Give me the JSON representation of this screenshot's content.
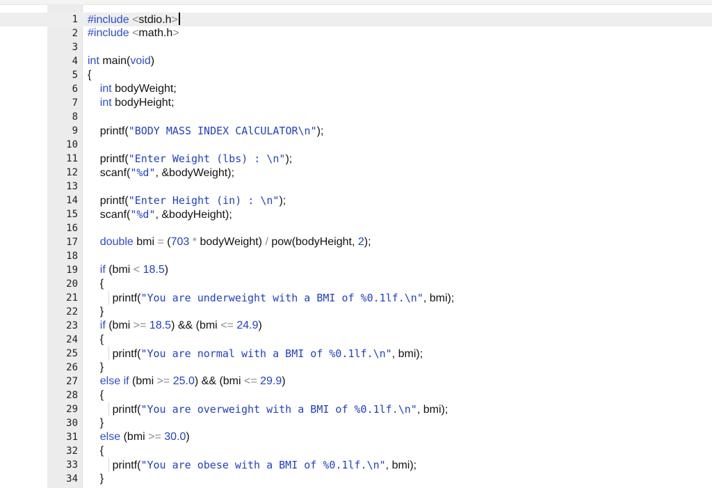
{
  "editor": {
    "language": "C",
    "cursor_line": 1,
    "lines": [
      {
        "num": "1"
      },
      {
        "num": "2"
      },
      {
        "num": "3"
      },
      {
        "num": "4"
      },
      {
        "num": "5"
      },
      {
        "num": "6"
      },
      {
        "num": "7"
      },
      {
        "num": "8"
      },
      {
        "num": "9"
      },
      {
        "num": "10"
      },
      {
        "num": "11"
      },
      {
        "num": "12"
      },
      {
        "num": "13"
      },
      {
        "num": "14"
      },
      {
        "num": "15"
      },
      {
        "num": "16"
      },
      {
        "num": "17"
      },
      {
        "num": "18"
      },
      {
        "num": "19"
      },
      {
        "num": "20"
      },
      {
        "num": "21"
      },
      {
        "num": "22"
      },
      {
        "num": "23"
      },
      {
        "num": "24"
      },
      {
        "num": "25"
      },
      {
        "num": "26"
      },
      {
        "num": "27"
      },
      {
        "num": "28"
      },
      {
        "num": "29"
      },
      {
        "num": "30"
      },
      {
        "num": "31"
      },
      {
        "num": "32"
      },
      {
        "num": "33"
      },
      {
        "num": "34"
      }
    ],
    "code": [
      "#include <stdio.h>",
      "#include <math.h>",
      "",
      "int main(void)",
      "{",
      "    int bodyWeight;",
      "    int bodyHeight;",
      "",
      "    printf(\"BODY MASS INDEX CAlCULATOR\\n\");",
      "",
      "    printf(\"Enter Weight (lbs) : \\n\");",
      "    scanf(\"%d\", &bodyWeight);",
      "",
      "    printf(\"Enter Height (in) : \\n\");",
      "    scanf(\"%d\", &bodyHeight);",
      "",
      "    double bmi = (703 * bodyWeight) / pow(bodyHeight, 2);",
      "",
      "    if (bmi < 18.5)",
      "    {",
      "        printf(\"You are underweight with a BMI of %0.1lf.\\n\", bmi);",
      "    }",
      "    if (bmi >= 18.5) && (bmi <= 24.9)",
      "    {",
      "        printf(\"You are normal with a BMI of %0.1lf.\\n\", bmi);",
      "    }",
      "    else if (bmi >= 25.0) && (bmi <= 29.9)",
      "    {",
      "        printf(\"You are overweight with a BMI of %0.1lf.\\n\", bmi);",
      "    }",
      "    else (bmi >= 30.0)",
      "    {",
      "        printf(\"You are obese with a BMI of %0.1lf.\\n\", bmi);",
      "    }"
    ],
    "colors": {
      "keyword": "#2b4bd1",
      "string": "#1f3fc8",
      "number": "#1f3fc8",
      "operator": "#8a8a8a",
      "text": "#111111",
      "gutter": "#ececec",
      "active_line": "#eeeeee"
    }
  }
}
